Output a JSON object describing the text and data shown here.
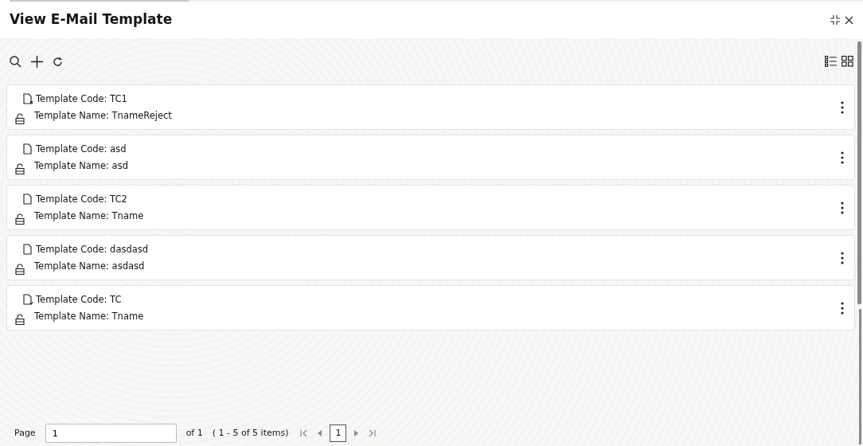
{
  "window": {
    "title": "View E-Mail Template"
  },
  "templates": [
    {
      "code": "Template Code: TC1",
      "name": "Template Name: TnameReject",
      "kind": "rejected",
      "locked": false
    },
    {
      "code": "Template Code: asd",
      "name": "Template Name: asd",
      "kind": "plain",
      "locked": false
    },
    {
      "code": "Template Code: TC2",
      "name": "Template Name: Tname",
      "kind": "plain",
      "locked": false
    },
    {
      "code": "Template Code: dasdasd",
      "name": "Template Name: asdasd",
      "kind": "plain",
      "locked": false
    },
    {
      "code": "Template Code: TC",
      "name": "Template Name: Tname",
      "kind": "authorized",
      "locked": false
    }
  ],
  "pager": {
    "label": "Page",
    "value": "1",
    "of": "of 1",
    "range": "( 1 - 5 of 5 items)",
    "current": "1"
  }
}
